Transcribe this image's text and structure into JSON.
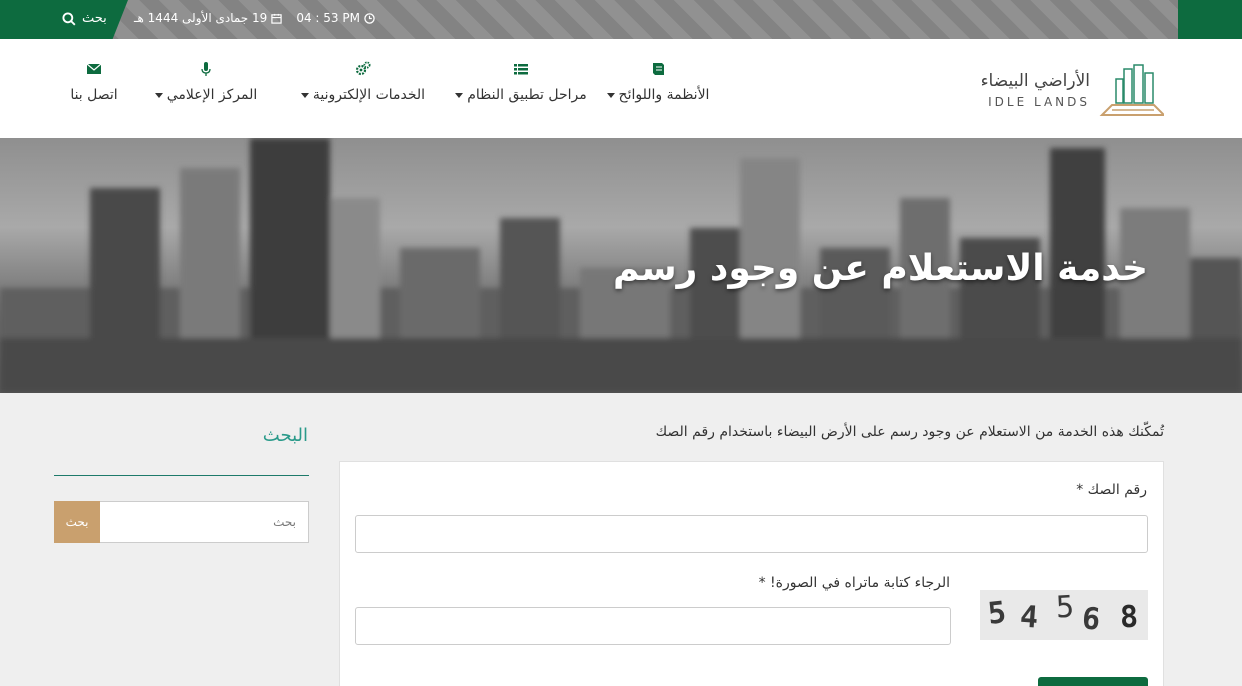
{
  "topbar": {
    "search_label": "بحث",
    "date": "19 جمادى الأولى 1444 هـ",
    "time": "04 : 53 PM",
    "color_green": "#0d6b3f"
  },
  "logo": {
    "arabic": "الأراضي البيضاء",
    "english": "IDLE LANDS"
  },
  "nav": {
    "items": [
      {
        "label": "الأنظمة واللوائح",
        "icon": "book-icon",
        "dropdown": true
      },
      {
        "label": "مراحل تطبيق النظام",
        "icon": "list-icon",
        "dropdown": true
      },
      {
        "label": "الخدمات الإلكترونية",
        "icon": "gears-icon",
        "dropdown": true
      },
      {
        "label": "المركز الإعلامي",
        "icon": "microphone-icon",
        "dropdown": true
      },
      {
        "label": "اتصل بنا",
        "icon": "envelope-icon",
        "dropdown": false
      }
    ]
  },
  "hero": {
    "title": "خدمة الاستعلام عن وجود رسم"
  },
  "main": {
    "intro": "تُمكّنك هذه الخدمة من الاستعلام عن وجود رسم على الأرض البيضاء باستخدام رقم الصك",
    "deed_label": "رقم الصك *",
    "captcha_label": "الرجاء كتابة ماتراه في الصورة! *",
    "captcha_digits": [
      "5",
      "4",
      "5",
      "6",
      "8"
    ]
  },
  "sidebar": {
    "title": "البحث",
    "search_placeholder": "بحث",
    "search_button": "بحث",
    "accent": "#c9a06e"
  }
}
